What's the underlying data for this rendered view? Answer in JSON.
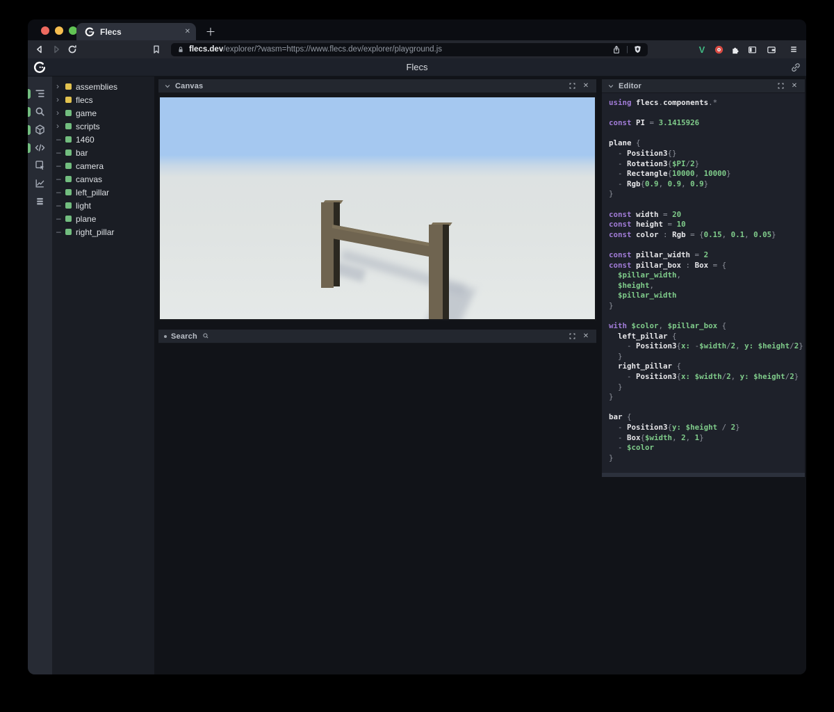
{
  "glyphs": {
    "close": "✕",
    "plus": "＋",
    "bullet": "•",
    "chevron_right": "›",
    "leaf_dash": "–"
  },
  "browser": {
    "tab": {
      "title": "Flecs"
    },
    "url": {
      "domain": "flecs.dev",
      "rest": "/explorer/?wasm=https://www.flecs.dev/explorer/playground.js"
    },
    "extensions": {
      "vue_badge": "V"
    }
  },
  "app": {
    "header": {
      "title": "Flecs"
    },
    "rail": {
      "icons": [
        "outline-tree",
        "search",
        "cube",
        "code",
        "inspector",
        "chart",
        "rows"
      ],
      "active": [
        true,
        true,
        true,
        true,
        false,
        false,
        false
      ]
    },
    "tree": {
      "items": [
        {
          "label": "assemblies",
          "color": "yellow",
          "expandable": true
        },
        {
          "label": "flecs",
          "color": "yellow",
          "expandable": true
        },
        {
          "label": "game",
          "color": "green",
          "expandable": true
        },
        {
          "label": "scripts",
          "color": "green",
          "expandable": true
        },
        {
          "label": "1460",
          "color": "green",
          "expandable": false
        },
        {
          "label": "bar",
          "color": "green",
          "expandable": false
        },
        {
          "label": "camera",
          "color": "green",
          "expandable": false
        },
        {
          "label": "canvas",
          "color": "green",
          "expandable": false
        },
        {
          "label": "left_pillar",
          "color": "green",
          "expandable": false
        },
        {
          "label": "light",
          "color": "green",
          "expandable": false
        },
        {
          "label": "plane",
          "color": "green",
          "expandable": false
        },
        {
          "label": "right_pillar",
          "color": "green",
          "expandable": false
        }
      ]
    },
    "canvas_panel": {
      "title": "Canvas"
    },
    "search_panel": {
      "title": "Search"
    },
    "editor_panel": {
      "title": "Editor",
      "code": [
        [
          [
            "k",
            "using"
          ],
          [
            "p",
            " "
          ],
          [
            "i",
            "flecs"
          ],
          [
            "p",
            "."
          ],
          [
            "i",
            "components"
          ],
          [
            "p",
            ".*"
          ]
        ],
        [],
        [
          [
            "k",
            "const"
          ],
          [
            "p",
            " "
          ],
          [
            "i",
            "PI"
          ],
          [
            "p",
            " = "
          ],
          [
            "v",
            "3.1415926"
          ]
        ],
        [],
        [
          [
            "i",
            "plane"
          ],
          [
            "p",
            " {"
          ]
        ],
        [
          [
            "p",
            "  - "
          ],
          [
            "i",
            "Position3"
          ],
          [
            "p",
            "{}"
          ]
        ],
        [
          [
            "p",
            "  - "
          ],
          [
            "i",
            "Rotation3"
          ],
          [
            "p",
            "{"
          ],
          [
            "v",
            "$PI"
          ],
          [
            "p",
            "/"
          ],
          [
            "v",
            "2"
          ],
          [
            "p",
            "}"
          ]
        ],
        [
          [
            "p",
            "  - "
          ],
          [
            "i",
            "Rectangle"
          ],
          [
            "p",
            "{"
          ],
          [
            "v",
            "10000"
          ],
          [
            "p",
            ", "
          ],
          [
            "v",
            "10000"
          ],
          [
            "p",
            "}"
          ]
        ],
        [
          [
            "p",
            "  - "
          ],
          [
            "i",
            "Rgb"
          ],
          [
            "p",
            "{"
          ],
          [
            "v",
            "0.9"
          ],
          [
            "p",
            ", "
          ],
          [
            "v",
            "0.9"
          ],
          [
            "p",
            ", "
          ],
          [
            "v",
            "0.9"
          ],
          [
            "p",
            "}"
          ]
        ],
        [
          [
            "p",
            "}"
          ]
        ],
        [],
        [
          [
            "k",
            "const"
          ],
          [
            "p",
            " "
          ],
          [
            "i",
            "width"
          ],
          [
            "p",
            " = "
          ],
          [
            "v",
            "20"
          ]
        ],
        [
          [
            "k",
            "const"
          ],
          [
            "p",
            " "
          ],
          [
            "i",
            "height"
          ],
          [
            "p",
            " = "
          ],
          [
            "v",
            "10"
          ]
        ],
        [
          [
            "k",
            "const"
          ],
          [
            "p",
            " "
          ],
          [
            "i",
            "color"
          ],
          [
            "p",
            " : "
          ],
          [
            "i",
            "Rgb"
          ],
          [
            "p",
            " = {"
          ],
          [
            "v",
            "0.15"
          ],
          [
            "p",
            ", "
          ],
          [
            "v",
            "0.1"
          ],
          [
            "p",
            ", "
          ],
          [
            "v",
            "0.05"
          ],
          [
            "p",
            "}"
          ]
        ],
        [],
        [
          [
            "k",
            "const"
          ],
          [
            "p",
            " "
          ],
          [
            "i",
            "pillar_width"
          ],
          [
            "p",
            " = "
          ],
          [
            "v",
            "2"
          ]
        ],
        [
          [
            "k",
            "const"
          ],
          [
            "p",
            " "
          ],
          [
            "i",
            "pillar_box"
          ],
          [
            "p",
            " : "
          ],
          [
            "i",
            "Box"
          ],
          [
            "p",
            " = {"
          ]
        ],
        [
          [
            "p",
            "  "
          ],
          [
            "v",
            "$pillar_width"
          ],
          [
            "p",
            ","
          ]
        ],
        [
          [
            "p",
            "  "
          ],
          [
            "v",
            "$height"
          ],
          [
            "p",
            ","
          ]
        ],
        [
          [
            "p",
            "  "
          ],
          [
            "v",
            "$pillar_width"
          ]
        ],
        [
          [
            "p",
            "}"
          ]
        ],
        [],
        [
          [
            "k",
            "with"
          ],
          [
            "p",
            " "
          ],
          [
            "v",
            "$color"
          ],
          [
            "p",
            ", "
          ],
          [
            "v",
            "$pillar_box"
          ],
          [
            "p",
            " {"
          ]
        ],
        [
          [
            "p",
            "  "
          ],
          [
            "i",
            "left_pillar"
          ],
          [
            "p",
            " {"
          ]
        ],
        [
          [
            "p",
            "    - "
          ],
          [
            "i",
            "Position3"
          ],
          [
            "p",
            "{"
          ],
          [
            "v",
            "x:"
          ],
          [
            "p",
            " -"
          ],
          [
            "v",
            "$width"
          ],
          [
            "p",
            "/"
          ],
          [
            "v",
            "2"
          ],
          [
            "p",
            ", "
          ],
          [
            "v",
            "y:"
          ],
          [
            "p",
            " "
          ],
          [
            "v",
            "$height"
          ],
          [
            "p",
            "/"
          ],
          [
            "v",
            "2"
          ],
          [
            "p",
            "}"
          ]
        ],
        [
          [
            "p",
            "  }"
          ]
        ],
        [
          [
            "p",
            "  "
          ],
          [
            "i",
            "right_pillar"
          ],
          [
            "p",
            " {"
          ]
        ],
        [
          [
            "p",
            "    - "
          ],
          [
            "i",
            "Position3"
          ],
          [
            "p",
            "{"
          ],
          [
            "v",
            "x:"
          ],
          [
            "p",
            " "
          ],
          [
            "v",
            "$width"
          ],
          [
            "p",
            "/"
          ],
          [
            "v",
            "2"
          ],
          [
            "p",
            ", "
          ],
          [
            "v",
            "y:"
          ],
          [
            "p",
            " "
          ],
          [
            "v",
            "$height"
          ],
          [
            "p",
            "/"
          ],
          [
            "v",
            "2"
          ],
          [
            "p",
            "}"
          ]
        ],
        [
          [
            "p",
            "  }"
          ]
        ],
        [
          [
            "p",
            "}"
          ]
        ],
        [],
        [
          [
            "i",
            "bar"
          ],
          [
            "p",
            " {"
          ]
        ],
        [
          [
            "p",
            "  - "
          ],
          [
            "i",
            "Position3"
          ],
          [
            "p",
            "{"
          ],
          [
            "v",
            "y:"
          ],
          [
            "p",
            " "
          ],
          [
            "v",
            "$height"
          ],
          [
            "p",
            " / "
          ],
          [
            "v",
            "2"
          ],
          [
            "p",
            "}"
          ]
        ],
        [
          [
            "p",
            "  - "
          ],
          [
            "i",
            "Box"
          ],
          [
            "p",
            "{"
          ],
          [
            "v",
            "$width"
          ],
          [
            "p",
            ", "
          ],
          [
            "v",
            "2"
          ],
          [
            "p",
            ", "
          ],
          [
            "v",
            "1"
          ],
          [
            "p",
            "}"
          ]
        ],
        [
          [
            "p",
            "  - "
          ],
          [
            "v",
            "$color"
          ]
        ],
        [
          [
            "p",
            "}"
          ]
        ]
      ]
    }
  },
  "colors": {
    "sky": "#a5c8f0",
    "ground": "#dfe3e2",
    "wood": "#6f6450",
    "wood_top": "#7d7159",
    "wood_side": "#2b2820",
    "shadow": "#a9b0bc",
    "accent_green": "#72bd7f",
    "accent_yellow": "#e2c24f",
    "code_keyword": "#a07bd6",
    "code_value": "#7fcb8a",
    "code_ident": "#e6e6e9",
    "code_punct": "#8d919b"
  }
}
